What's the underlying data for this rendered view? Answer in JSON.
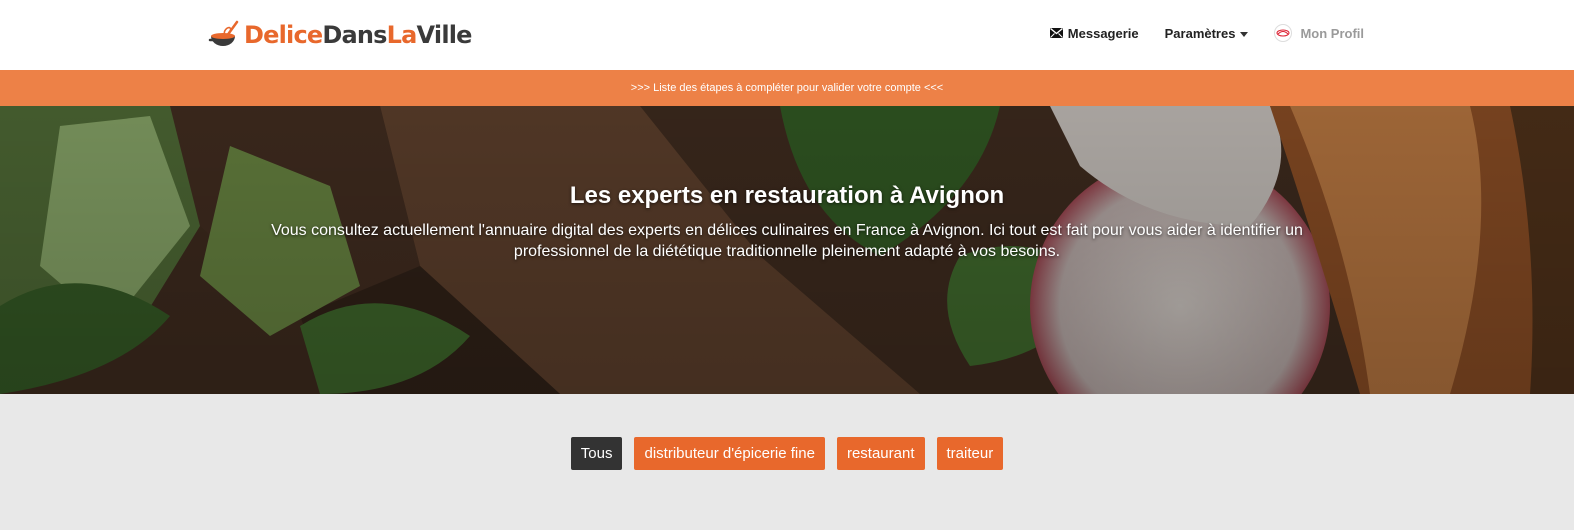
{
  "brand": {
    "part1": "Delice",
    "part2": "Dans",
    "part3": "La",
    "part4": "Ville",
    "accent_color": "#e8682c",
    "dark_color": "#3a3a3a",
    "icon": "cooking-pot-whisk-icon"
  },
  "nav": {
    "messages_label": "Messagerie",
    "messages_icon": "envelope-icon",
    "settings_label": "Paramètres",
    "profile_label": "Mon Profil"
  },
  "notice": {
    "text": ">>> Liste des étapes à compléter pour valider votre compte <<<",
    "color": "#ed8147"
  },
  "hero": {
    "title": "Les experts en restauration à Avignon",
    "description": "Vous consultez actuellement l'annuaire digital des experts en délices culinaires en France à Avignon. Ici tout est fait pour vous aider à identifier un professionnel de la diététique traditionnelle pleinement adapté à vos besoins."
  },
  "filters": {
    "items": [
      {
        "label": "Tous",
        "active": true
      },
      {
        "label": "distributeur d'épicerie fine",
        "active": false
      },
      {
        "label": "restaurant",
        "active": false
      },
      {
        "label": "traiteur",
        "active": false
      }
    ],
    "active_color": "#333333",
    "color": "#e8682c"
  }
}
